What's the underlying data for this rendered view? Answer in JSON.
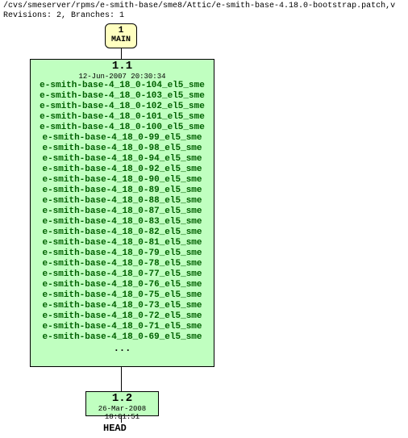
{
  "header": {
    "path": "/cvs/smeserver/rpms/e-smith-base/sme8/Attic/e-smith-base-4.18.0-bootstrap.patch,v",
    "revisions": "Revisions: 2, Branches: 1"
  },
  "main_branch": {
    "number": "1",
    "label": "MAIN"
  },
  "rev1": {
    "number": "1.1",
    "date": "12-Jun-2007 20:30:34",
    "files": [
      "e-smith-base-4_18_0-104_el5_sme",
      "e-smith-base-4_18_0-103_el5_sme",
      "e-smith-base-4_18_0-102_el5_sme",
      "e-smith-base-4_18_0-101_el5_sme",
      "e-smith-base-4_18_0-100_el5_sme",
      "e-smith-base-4_18_0-99_el5_sme",
      "e-smith-base-4_18_0-98_el5_sme",
      "e-smith-base-4_18_0-94_el5_sme",
      "e-smith-base-4_18_0-92_el5_sme",
      "e-smith-base-4_18_0-90_el5_sme",
      "e-smith-base-4_18_0-89_el5_sme",
      "e-smith-base-4_18_0-88_el5_sme",
      "e-smith-base-4_18_0-87_el5_sme",
      "e-smith-base-4_18_0-83_el5_sme",
      "e-smith-base-4_18_0-82_el5_sme",
      "e-smith-base-4_18_0-81_el5_sme",
      "e-smith-base-4_18_0-79_el5_sme",
      "e-smith-base-4_18_0-78_el5_sme",
      "e-smith-base-4_18_0-77_el5_sme",
      "e-smith-base-4_18_0-76_el5_sme",
      "e-smith-base-4_18_0-75_el5_sme",
      "e-smith-base-4_18_0-73_el5_sme",
      "e-smith-base-4_18_0-72_el5_sme",
      "e-smith-base-4_18_0-71_el5_sme",
      "e-smith-base-4_18_0-69_el5_sme"
    ],
    "ellipsis": "..."
  },
  "rev2": {
    "number": "1.2",
    "date": "26-Mar-2008 18:01:51"
  },
  "head": "HEAD"
}
